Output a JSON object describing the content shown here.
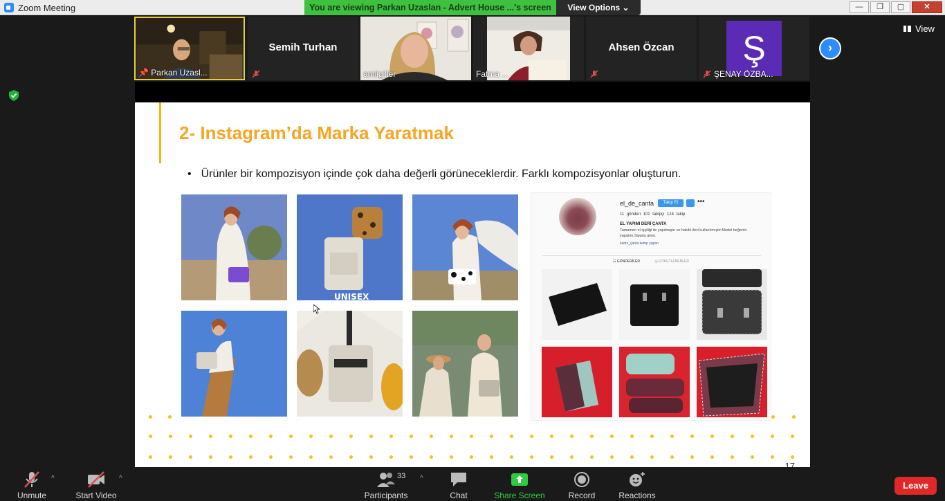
{
  "window": {
    "title": "Zoom Meeting",
    "buttons": {
      "minimize": "—",
      "restore": "❐",
      "maximize": "▢",
      "close": "✕"
    }
  },
  "share_banner": {
    "text": "You are viewing Parkan Uzaslan - Advert House ...'s screen",
    "view_options": "View Options ⌄",
    "color": "#3ec13e"
  },
  "participants": [
    {
      "name": "Parkan Uzasl...",
      "video": true,
      "pinned": true,
      "active": true
    },
    {
      "name": "Semih Turhan",
      "video": false,
      "muted": true
    },
    {
      "name": "amilgiller",
      "video": true
    },
    {
      "name": "Fatma ...",
      "video": true
    },
    {
      "name": "Ahsen Özcan",
      "video": false,
      "muted": true
    },
    {
      "name": "ŞENAY ÖZBA...",
      "video": false,
      "muted": true,
      "avatar_letter": "Ş"
    }
  ],
  "view_button": "View",
  "slide": {
    "title": "2- Instagram’da Marka Yaratmak",
    "bullet": "Ürünler bir kompozisyon içinde çok daha değerli görüneceklerdir. Farklı kompozisyonlar oluşturun.",
    "page_number": "17",
    "photo_overlay_text": "UNISEX",
    "accent_color": "#f6a623",
    "instagram": {
      "handle": "el_de_canta",
      "follow_label": "Takip Et",
      "more": "•••",
      "stats": "11 gönderi   101 takipçi   124 takip",
      "display_name": "EL YAPIMI DERİ ÇANTA",
      "bio": "Tamamen el işçiliği ile yapılmıştır ve hakiki deri kullanılmıştır.Model beğenin yapalım.Sipariş alınır.",
      "link": "kadın_çanta kamp yapan",
      "tabs": [
        "☷ GÖNDERİLER",
        "◎ ETİKETLENENLER"
      ]
    }
  },
  "toolbar": {
    "unmute": "Unmute",
    "start_video": "Start Video",
    "participants": "Participants",
    "participants_count": "33",
    "chat": "Chat",
    "share_screen": "Share Screen",
    "record": "Record",
    "reactions": "Reactions",
    "leave": "Leave",
    "share_color": "#2ecc40",
    "leave_color": "#e02828"
  }
}
